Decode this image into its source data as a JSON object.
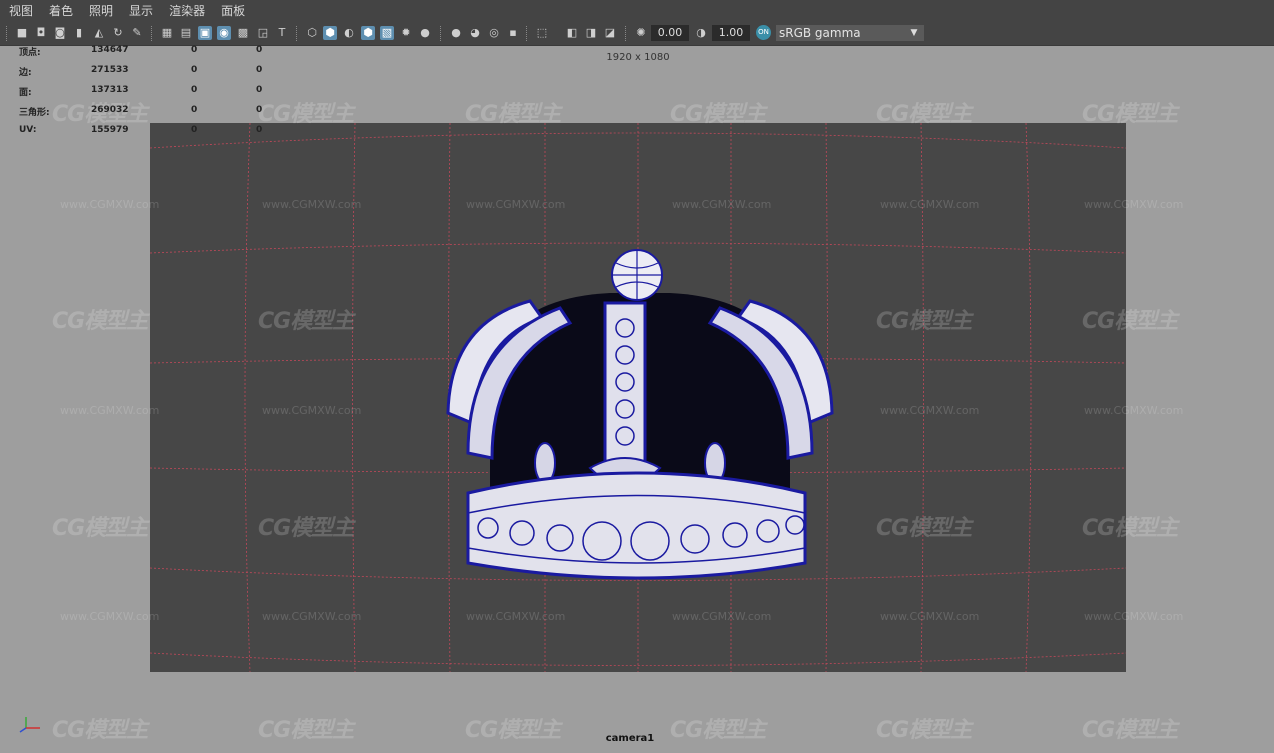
{
  "menu": [
    "视图",
    "着色",
    "照明",
    "显示",
    "渲染器",
    "面板"
  ],
  "toolbar": {
    "exposure": "0.00",
    "gamma": "1.00",
    "colorspace_badge": "ON",
    "colorspace": "sRGB gamma",
    "dropdown_arrow": "▼"
  },
  "hud": {
    "rows": [
      {
        "label": "顶点:",
        "v1": "134647",
        "v2": "0",
        "v3": "0"
      },
      {
        "label": "边:",
        "v1": "271533",
        "v2": "0",
        "v3": "0"
      },
      {
        "label": "面:",
        "v1": "137313",
        "v2": "0",
        "v3": "0"
      },
      {
        "label": "三角形:",
        "v1": "269032",
        "v2": "0",
        "v3": "0"
      },
      {
        "label": "UV:",
        "v1": "155979",
        "v2": "0",
        "v3": "0"
      }
    ]
  },
  "resolution": "1920 x 1080",
  "camera": "camera1",
  "watermark": {
    "logo": "CG模型主",
    "url": "www.CGMXW.com"
  },
  "colors": {
    "menubar_bg": "#444444",
    "panel_bg": "#9e9e9e",
    "viewport_bg": "#474747",
    "wireframe": "#1a1aa0",
    "mesh_fill": "#e8e8f0",
    "grid_line": "#c0485a",
    "accent": "#5e8fb0"
  },
  "icons": [
    "camera-icon",
    "film-gate-icon",
    "grid-icon",
    "wireframe-icon",
    "smooth-shade-icon",
    "textured-icon",
    "lights-icon",
    "isolate-icon",
    "xray-icon",
    "exposure-icon",
    "gamma-icon",
    "colorspace-icon"
  ]
}
